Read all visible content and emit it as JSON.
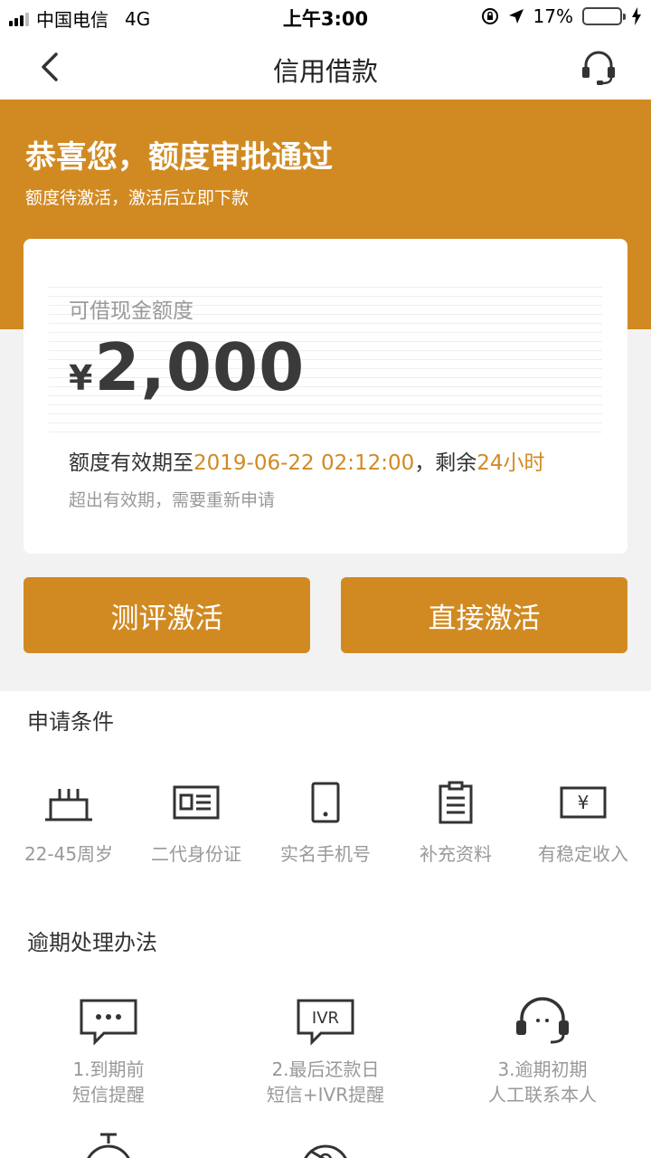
{
  "status_bar": {
    "carrier": "中国电信",
    "network": "4G",
    "time": "上午3:00",
    "battery": "17%",
    "battery_level": 0.17,
    "battery_color": "#e53935"
  },
  "nav": {
    "title": "信用借款",
    "back_icon": "chevron-left-icon",
    "service_icon": "headset-icon"
  },
  "hero": {
    "title": "恭喜您，额度审批通过",
    "subtitle": "额度待激活，激活后立即下款",
    "accent_color": "#d18a22"
  },
  "card": {
    "label": "可借现金额度",
    "currency": "¥",
    "amount": "2,000",
    "valid_prefix": "额度有效期至",
    "valid_date": "2019-06-22 02:12:00",
    "valid_mid": "，剩余",
    "remaining": "24小时",
    "note": "超出有效期，需要重新申请"
  },
  "buttons": {
    "evaluate": "测评激活",
    "direct": "直接激活"
  },
  "conditions": {
    "title": "申请条件",
    "items": [
      {
        "label": "22-45周岁",
        "icon": "cake-icon"
      },
      {
        "label": "二代身份证",
        "icon": "id-card-icon"
      },
      {
        "label": "实名手机号",
        "icon": "phone-icon"
      },
      {
        "label": "补充资料",
        "icon": "clipboard-icon"
      },
      {
        "label": "有稳定收入",
        "icon": "cash-icon"
      }
    ]
  },
  "overdue": {
    "title": "逾期处理办法",
    "items": [
      {
        "line1": "1.到期前",
        "line2": "短信提醒",
        "icon": "sms-icon"
      },
      {
        "line1": "2.最后还款日",
        "line2": "短信+IVR提醒",
        "icon": "ivr-icon"
      },
      {
        "line1": "3.逾期初期",
        "line2": "人工联系本人",
        "icon": "headset-icon"
      }
    ]
  }
}
